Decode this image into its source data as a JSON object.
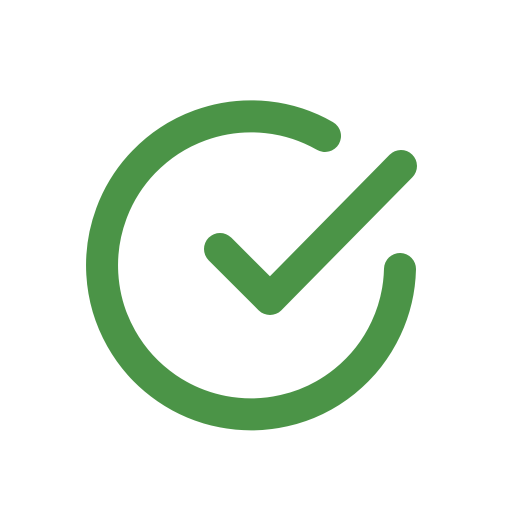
{
  "icon": {
    "name": "check-circle-icon",
    "color": "#4B9447",
    "background": "#FFFFFF"
  }
}
